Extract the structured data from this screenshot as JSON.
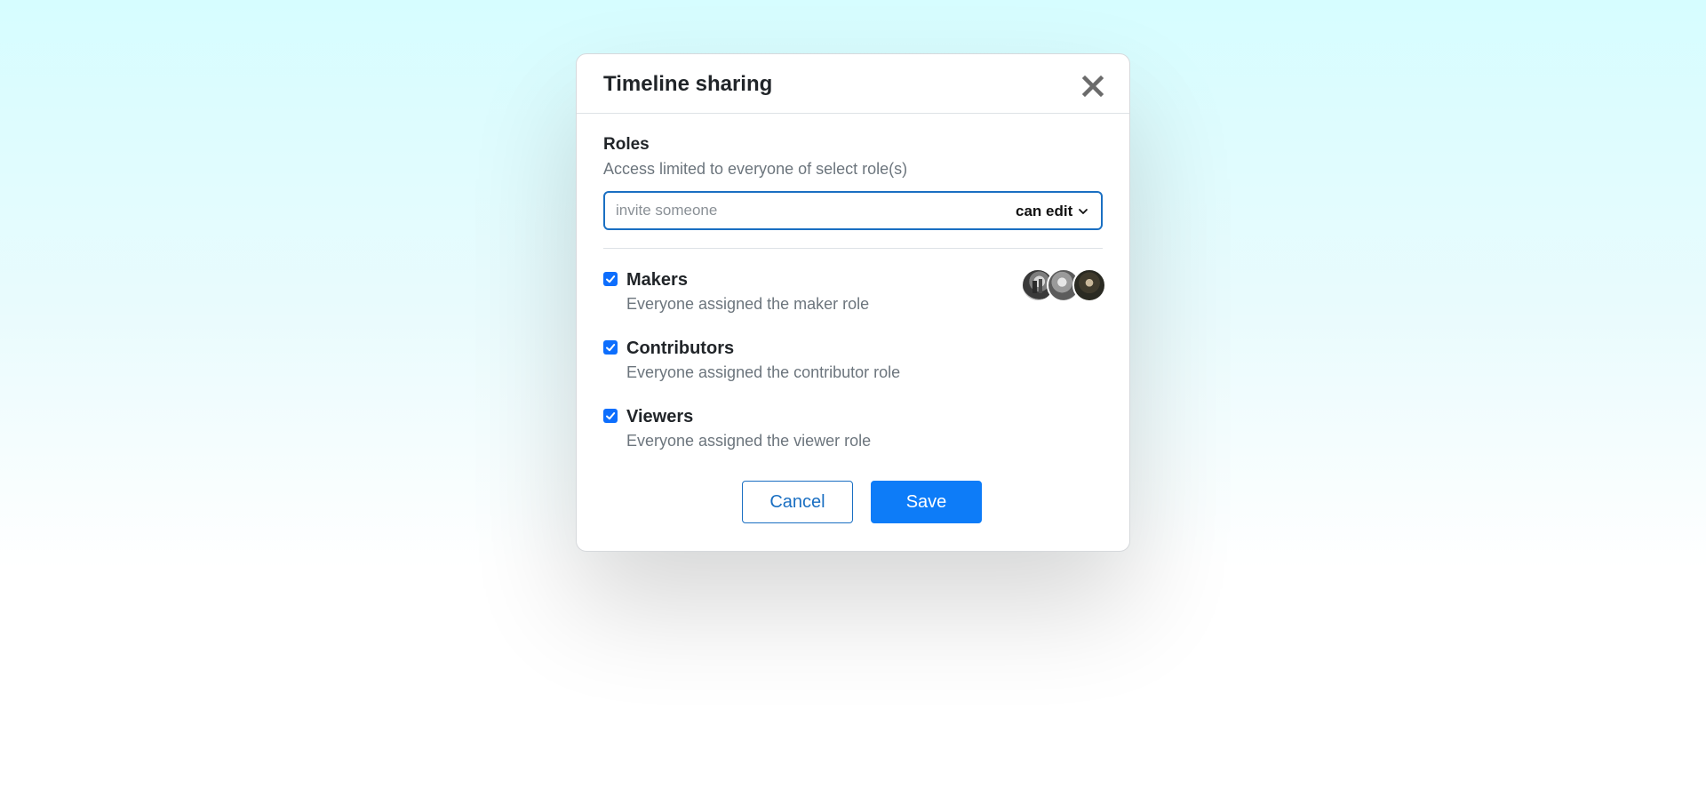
{
  "dialog": {
    "title": "Timeline sharing",
    "close_icon": "close-icon"
  },
  "roles_section": {
    "title": "Roles",
    "description": "Access limited to everyone of select role(s)"
  },
  "invite": {
    "placeholder": "invite someone",
    "value": "",
    "permission": "can edit",
    "permission_icon": "chevron-down-icon",
    "accent": "#1a6fc2"
  },
  "roles": [
    {
      "name": "Makers",
      "description": "Everyone assigned the maker role",
      "checked": true
    },
    {
      "name": "Contributors",
      "description": "Everyone assigned the contributor role",
      "checked": true
    },
    {
      "name": "Viewers",
      "description": "Everyone assigned the viewer role",
      "checked": true
    }
  ],
  "makers_avatars": [
    {
      "name": "avatar-1"
    },
    {
      "name": "avatar-2"
    },
    {
      "name": "avatar-3"
    }
  ],
  "actions": {
    "cancel_label": "Cancel",
    "save_label": "Save",
    "primary_color": "#0d7cf8"
  }
}
